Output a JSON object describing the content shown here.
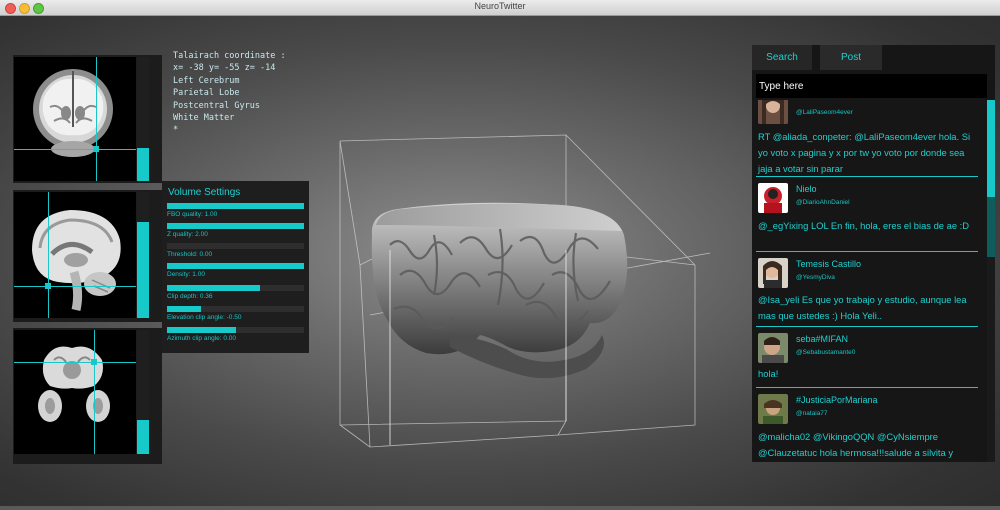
{
  "window": {
    "title": "NeuroTwitter"
  },
  "coords": {
    "heading": "Talairach coordinate :",
    "xyz": "x= -38 y= -55 z= -14",
    "lines": [
      "Left Cerebrum",
      "Parietal Lobe",
      "Postcentral Gyrus",
      "White Matter",
      "*"
    ]
  },
  "slices": [
    {
      "name": "coronal",
      "level": 0.26
    },
    {
      "name": "sagittal",
      "level": 0.77
    },
    {
      "name": "axial",
      "level": 0.23
    }
  ],
  "volume_settings": {
    "title": "Volume Settings",
    "items": [
      {
        "label": "FBO quality: 1.00",
        "value": 1.0
      },
      {
        "label": "Z quality: 2.00",
        "value": 1.0
      },
      {
        "label": "Threshold: 0.00",
        "value": 0.0
      },
      {
        "label": "Density: 1.00",
        "value": 1.0
      },
      {
        "label": "Clip depth: 0.36",
        "value": 0.68
      },
      {
        "label": "Elevation clip angle: -0.50",
        "value": 0.25
      },
      {
        "label": "Azimuth clip angle: 0.00",
        "value": 0.5
      }
    ]
  },
  "panel": {
    "tabs": [
      "Search",
      "Post"
    ],
    "search_placeholder": "Type here",
    "tweets": [
      {
        "name": "",
        "handle": "@LaliPaseom4ever",
        "text": "RT @aliada_conpeter: @LaliPaseom4ever hola. Si yo voto x pagina y x por tw yo voto por donde sea jaja a votar sin parar"
      },
      {
        "name": "Nielo",
        "handle": "@DiarioAhnDaniel",
        "text": "@_egYixing LOL En fin, hola, eres el bias de ae :D"
      },
      {
        "name": "Temesis Castillo",
        "handle": "@YesmyDiva",
        "text": "@Isa_yeli Es que yo trabajo y estudio, aunque lea mas que ustedes :) Hola Yeli.."
      },
      {
        "name": "seba#MIFAN",
        "handle": "@Sebabustamante0",
        "text": "hola!"
      },
      {
        "name": "#JusticiaPorMariana",
        "handle": "@nataia77",
        "text": "@malicha02 @VikingoQQN @CyNsiempre @Clauzetatuc hola hermosa!!!salude a silvita y"
      }
    ]
  },
  "colors": {
    "accent": "#1fd0d0",
    "panel_bg": "#161616"
  }
}
